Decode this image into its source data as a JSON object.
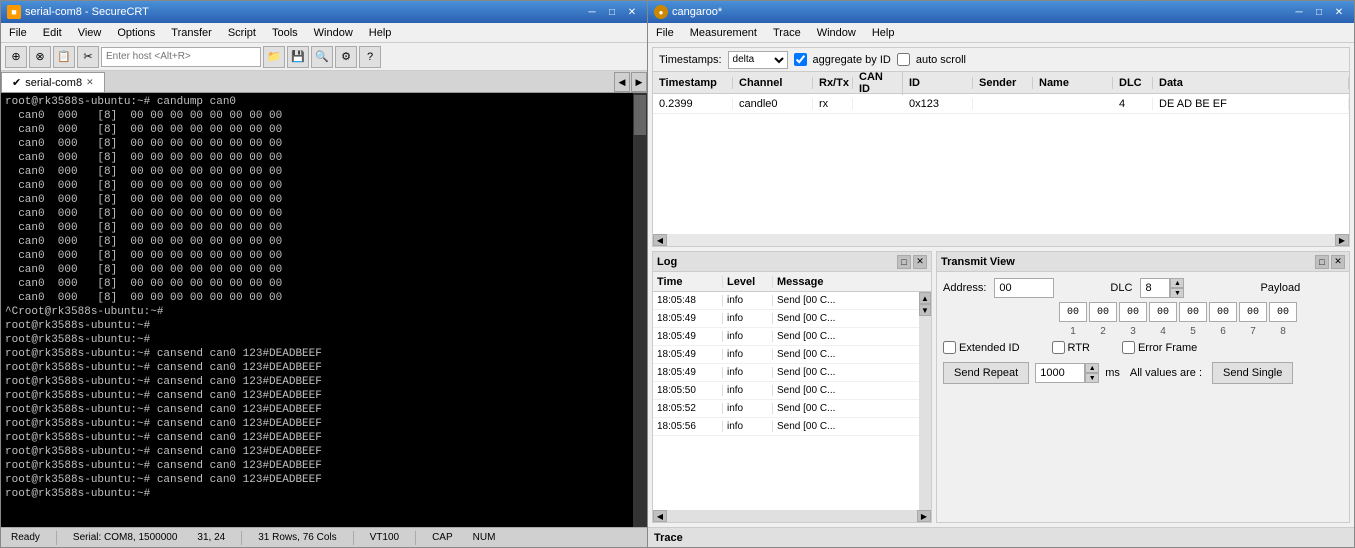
{
  "securecrt": {
    "title": "serial-com8 - SecureCRT",
    "icon": "■",
    "menu": [
      "File",
      "Edit",
      "View",
      "Options",
      "Transfer",
      "Script",
      "Tools",
      "Window",
      "Help"
    ],
    "toolbar_placeholder": "Enter host <Alt+R>",
    "tab_label": "serial-com8",
    "terminal_lines": [
      "root@rk3588s-ubuntu:~# candump can0",
      "  can0  000   [8]  00 00 00 00 00 00 00 00",
      "  can0  000   [8]  00 00 00 00 00 00 00 00",
      "  can0  000   [8]  00 00 00 00 00 00 00 00",
      "  can0  000   [8]  00 00 00 00 00 00 00 00",
      "  can0  000   [8]  00 00 00 00 00 00 00 00",
      "  can0  000   [8]  00 00 00 00 00 00 00 00",
      "  can0  000   [8]  00 00 00 00 00 00 00 00",
      "  can0  000   [8]  00 00 00 00 00 00 00 00",
      "  can0  000   [8]  00 00 00 00 00 00 00 00",
      "  can0  000   [8]  00 00 00 00 00 00 00 00",
      "  can0  000   [8]  00 00 00 00 00 00 00 00",
      "  can0  000   [8]  00 00 00 00 00 00 00 00",
      "  can0  000   [8]  00 00 00 00 00 00 00 00",
      "  can0  000   [8]  00 00 00 00 00 00 00 00",
      "^Croot@rk3588s-ubuntu:~#",
      "root@rk3588s-ubuntu:~#",
      "root@rk3588s-ubuntu:~#",
      "root@rk3588s-ubuntu:~# cansend can0 123#DEADBEEF",
      "root@rk3588s-ubuntu:~# cansend can0 123#DEADBEEF",
      "root@rk3588s-ubuntu:~# cansend can0 123#DEADBEEF",
      "root@rk3588s-ubuntu:~# cansend can0 123#DEADBEEF",
      "root@rk3588s-ubuntu:~# cansend can0 123#DEADBEEF",
      "root@rk3588s-ubuntu:~# cansend can0 123#DEADBEEF",
      "root@rk3588s-ubuntu:~# cansend can0 123#DEADBEEF",
      "root@rk3588s-ubuntu:~# cansend can0 123#DEADBEEF",
      "root@rk3588s-ubuntu:~# cansend can0 123#DEADBEEF",
      "root@rk3588s-ubuntu:~# cansend can0 123#DEADBEEF",
      "root@rk3588s-ubuntu:~# "
    ],
    "status": {
      "ready": "Ready",
      "serial": "Serial: COM8, 1500000",
      "rows_cols": "31, 24",
      "dimensions": "31 Rows, 76 Cols",
      "terminal": "VT100",
      "cap": "CAP",
      "num": "NUM"
    }
  },
  "cangaroo": {
    "title": "cangaroo*",
    "icon": "●",
    "menu": [
      "File",
      "Measurement",
      "Trace",
      "Window",
      "Help"
    ],
    "timestamps": {
      "label": "Timestamps:",
      "mode": "delta",
      "aggregate_label": "aggregate by ID",
      "auto_scroll_label": "auto scroll"
    },
    "table_headers": [
      "Timestamp",
      "Channel",
      "Rx/Tx",
      "CAN ID",
      "Sender",
      "Name",
      "DLC",
      "Data"
    ],
    "table_rows": [
      {
        "timestamp": "0.2399",
        "channel": "candle0",
        "rxtx": "rx",
        "can": "",
        "id": "0x123",
        "sender": "",
        "name": "",
        "dlc": "4",
        "data": "DE AD BE EF"
      }
    ],
    "log": {
      "title": "Log",
      "headers": [
        "Time",
        "Level",
        "Message"
      ],
      "rows": [
        {
          "time": "18:05:48",
          "level": "info",
          "message": "Send [00 C..."
        },
        {
          "time": "18:05:49",
          "level": "info",
          "message": "Send [00 C..."
        },
        {
          "time": "18:05:49",
          "level": "info",
          "message": "Send [00 C..."
        },
        {
          "time": "18:05:49",
          "level": "info",
          "message": "Send [00 C..."
        },
        {
          "time": "18:05:49",
          "level": "info",
          "message": "Send [00 C..."
        },
        {
          "time": "18:05:50",
          "level": "info",
          "message": "Send [00 C..."
        },
        {
          "time": "18:05:52",
          "level": "info",
          "message": "Send [00 C..."
        },
        {
          "time": "18:05:56",
          "level": "info",
          "message": "Send [00 C..."
        }
      ]
    },
    "transmit": {
      "title": "Transmit View",
      "address_label": "Address:",
      "address_value": "00",
      "dlc_label": "DLC",
      "dlc_value": "8",
      "payload_label": "Payload",
      "payload_values": [
        "00",
        "00",
        "00",
        "00",
        "00",
        "00",
        "00",
        "00"
      ],
      "payload_nums": [
        "1",
        "2",
        "3",
        "4",
        "5",
        "6",
        "7",
        "8"
      ],
      "extended_id_label": "Extended ID",
      "rtr_label": "RTR",
      "error_frame_label": "Error Frame",
      "send_repeat_label": "Send Repeat",
      "send_repeat_value": "1000",
      "ms_label": "ms",
      "all_values_label": "All values are :",
      "send_single_label": "Send Single"
    },
    "trace_label": "Trace"
  }
}
